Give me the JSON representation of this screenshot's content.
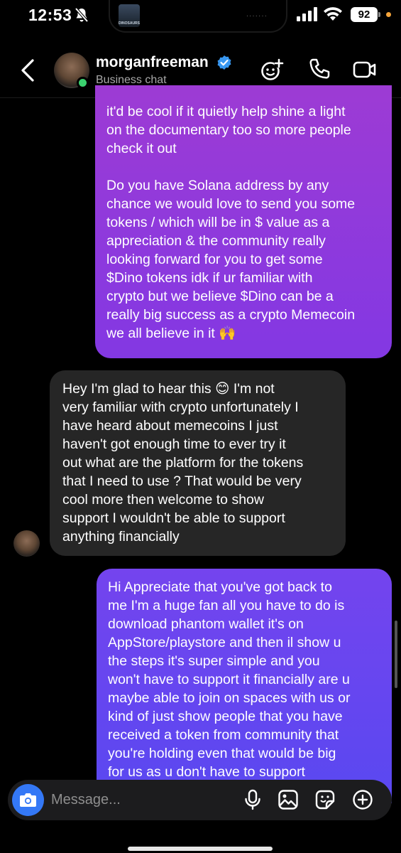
{
  "status": {
    "time": "12:53",
    "island_thumb_label": "DINOSAURS",
    "battery": "92"
  },
  "header": {
    "name": "morganfreeman",
    "subtitle": "Business chat"
  },
  "messages": [
    {
      "direction": "outgoing",
      "paragraphs": [
        "it'd be cool if it quietly help shine a light\non the documentary too so more people\ncheck it out",
        "Do you have Solana address by any\nchance we would love to send you some\ntokens / which will be in $ value as a\nappreciation & the community really\nlooking forward for you to get some\n$Dino tokens idk if ur familiar with\ncrypto but we believe $Dino can be a\nreally big success as a crypto Memecoin\nwe all believe in it 🙌"
      ]
    },
    {
      "direction": "incoming",
      "text": "Hey I'm glad to hear this 😊 I'm not\nvery familiar with crypto unfortunately I\nhave heard about memecoins I just\nhaven't got enough time to ever try it\nout what are the platform for the tokens\nthat I need to use ? That would be very\ncool more then welcome to show\nsupport I wouldn't be able to support\nanything financially"
    },
    {
      "direction": "outgoing",
      "text": "Hi Appreciate that you've got back to\nme I'm a huge fan all you have to do is\ndownload phantom wallet it's on\nAppStore/playstore and then il show u\nthe steps it's super simple and you\nwon't have to support it financially are u\nmaybe able to join on spaces with us or\nkind of just show people that you have\nreceived a token from community that\nyou're holding even that would be big\nfor us as u don't have to support"
    }
  ],
  "composer": {
    "placeholder": "Message..."
  },
  "colors": {
    "outgoing_top": "#9d3bd4",
    "outgoing_bottom": "#5948f1",
    "incoming": "#262626",
    "camera_button": "#3478f6",
    "online": "#3bd16f"
  }
}
